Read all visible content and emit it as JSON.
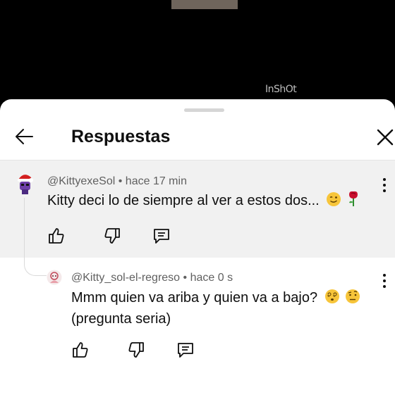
{
  "video": {
    "watermark": "InShOt"
  },
  "header": {
    "title": "Respuestas"
  },
  "parent_comment": {
    "handle": "@KittyexeSol",
    "separator": "•",
    "time": "hace 17 min",
    "text": "Kitty deci lo de siempre al ver a estos dos...",
    "emojis": [
      "winking-face",
      "rose"
    ]
  },
  "reply": {
    "handle": "@Kitty_sol-el-regreso",
    "separator": "•",
    "time": "hace 0 s",
    "text_line1": "Mmm quien va ariba y quien va a bajo?",
    "text_line2": "(pregunta seria)",
    "emojis": [
      "face-with-spiral-eyes",
      "face-with-raised-eyebrow"
    ]
  },
  "icons": [
    "back-arrow-icon",
    "close-icon",
    "like-icon",
    "dislike-icon",
    "reply-icon",
    "more-vert-icon"
  ],
  "colors": {
    "sheet": "#ffffff",
    "highlight": "#f1f1f1",
    "text": "#0f0f0f",
    "meta": "#606060"
  }
}
